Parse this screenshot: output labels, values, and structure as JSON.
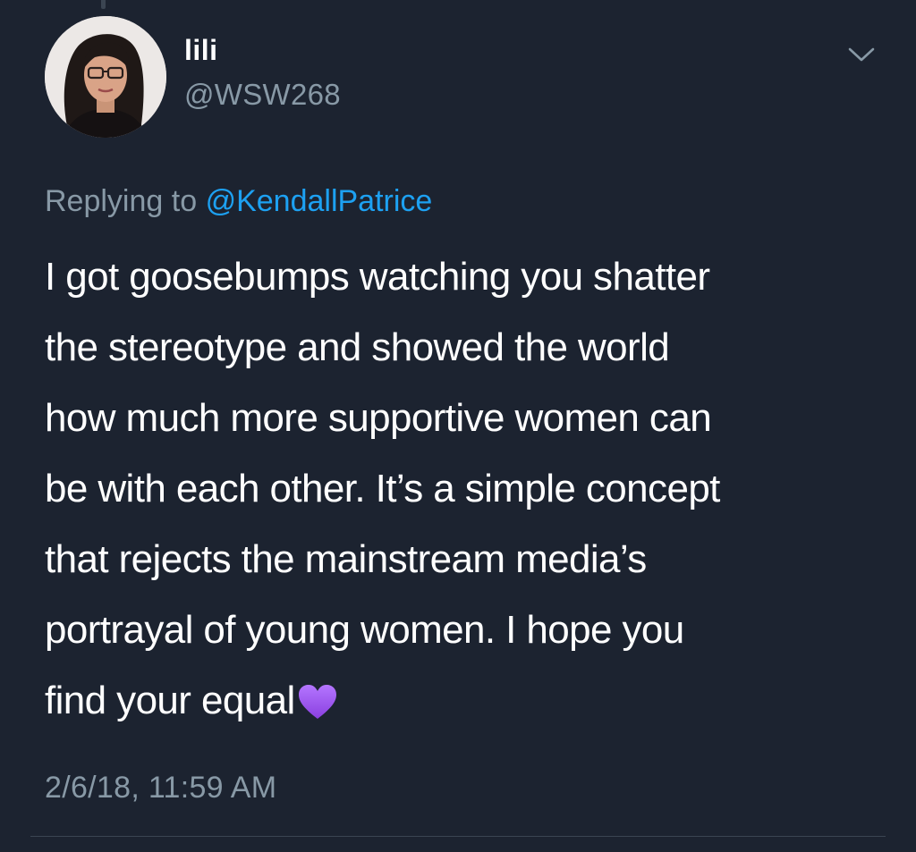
{
  "author": {
    "display_name": "lili",
    "handle": "@WSW268"
  },
  "reply_context": {
    "prefix": "Replying to",
    "mention": "@KendallPatrice"
  },
  "tweet": {
    "lines": [
      "I got goosebumps watching you shatter",
      "the stereotype and showed the world",
      "how much more supportive women can",
      "be with each other. It’s a simple concept",
      "that rejects the mainstream media’s",
      "portrayal of young women. I hope you",
      "find your equal"
    ],
    "emoji": "purple-heart",
    "timestamp": "2/6/18, 11:59 AM"
  },
  "colors": {
    "background": "#1c2330",
    "secondary_text": "#8899a6",
    "link": "#1da1f2",
    "heart": "#a25bf0"
  },
  "icons": {
    "menu": "chevron-down-icon",
    "emoji": "purple-heart-icon"
  }
}
